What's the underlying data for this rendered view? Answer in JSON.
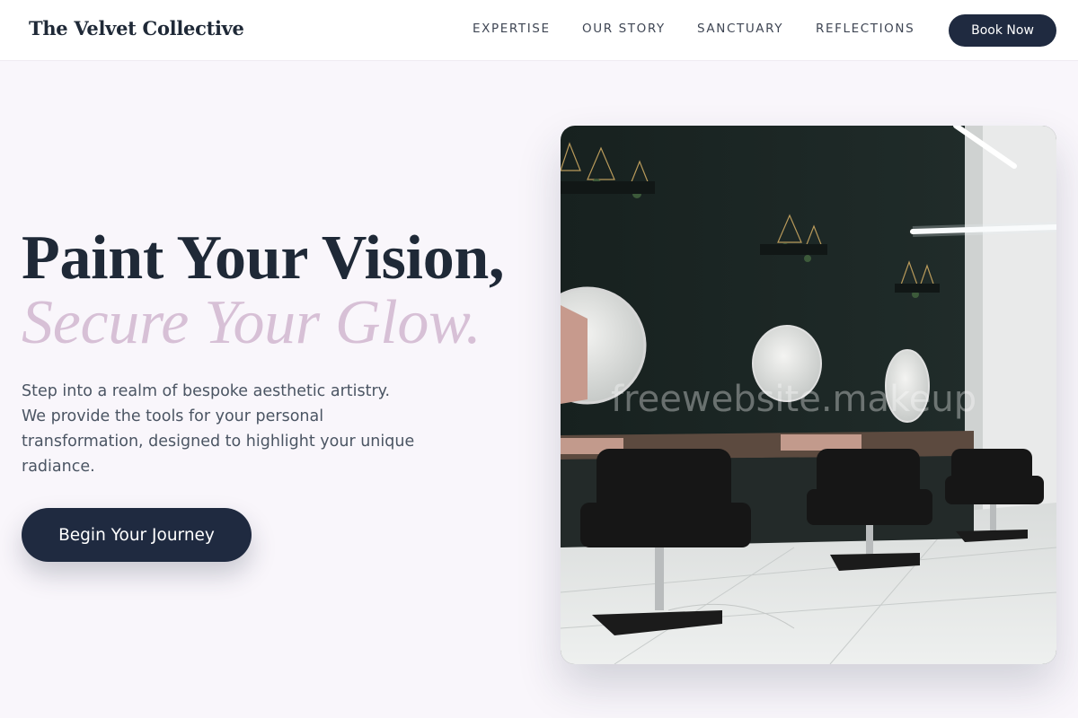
{
  "header": {
    "brand": "The Velvet Collective",
    "nav": [
      "EXPERTISE",
      "OUR STORY",
      "SANCTUARY",
      "REFLECTIONS"
    ],
    "book_label": "Book Now"
  },
  "hero": {
    "headline": "Paint Your Vision,",
    "headline_accent": "Secure Your Glow.",
    "intro": "Step into a realm of bespoke aesthetic artistry. We provide the tools for your personal transformation, designed to highlight your unique radiance.",
    "cta_label": "Begin Your Journey",
    "image_watermark": "freewebsite.makeup"
  },
  "colors": {
    "background": "#f9f6fb",
    "navy": "#1f2a40",
    "accent_lilac": "#d7c0d6",
    "heading": "#1f2937"
  }
}
